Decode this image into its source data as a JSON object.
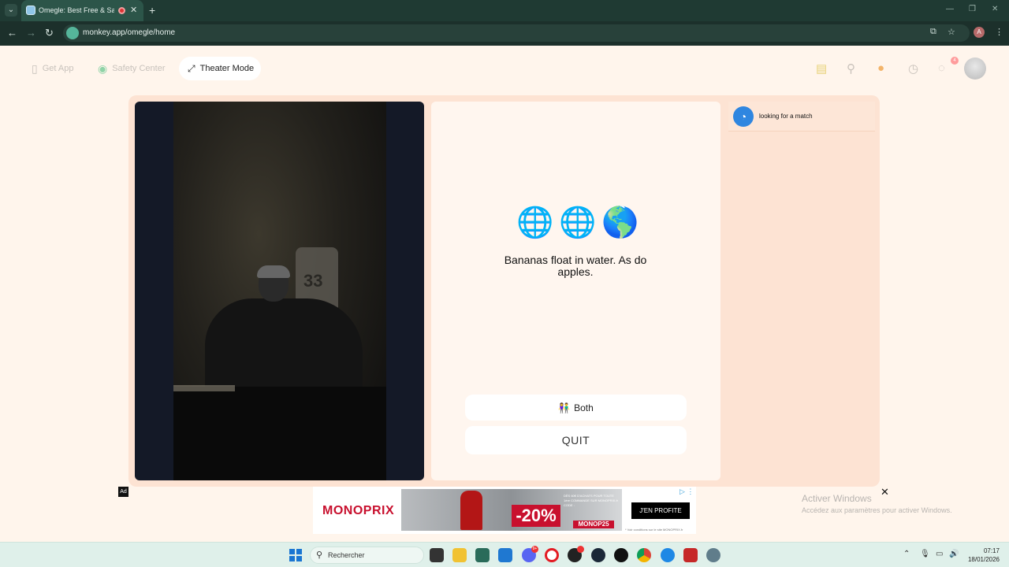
{
  "browser": {
    "tab_title": "Omegle: Best Free & Safe V",
    "tab_close": "✕",
    "new_tab": "+",
    "url": "monkey.app/omegle/home",
    "profile_initial": "A"
  },
  "header": {
    "get_app": "Get App",
    "safety_center": "Safety Center",
    "theater_mode": "Theater Mode",
    "notification_count": "4"
  },
  "video": {
    "jersey_number": "33"
  },
  "center": {
    "fact": "Bananas float in water. As do apples.",
    "gender_filter": "Both",
    "quit": "QUIT"
  },
  "side": {
    "status": "looking for a match"
  },
  "ad": {
    "tag": "Ad",
    "brand": "MONOPRIX",
    "discount": "-20%",
    "fine_print": "DÈS 60€ D'ACHATS POUR TOUTE 1ère COMMANDE SUR MONOPRIX.fr CODE :",
    "code": "MONOP25",
    "cta": "J'EN PROFITE",
    "legal": "* Voir conditions sur le site MONOPRIX.fr",
    "close": "✕"
  },
  "windows_watermark": {
    "title": "Activer Windows",
    "subtitle": "Accédez aux paramètres pour activer Windows."
  },
  "taskbar": {
    "search_placeholder": "Rechercher",
    "discord_badge": "9+",
    "time": "07:17",
    "date": "18/01/2026"
  },
  "colors": {
    "page_bg": "#fff5ec",
    "panel_bg": "#fde3d3",
    "accent_blue": "#2f86e0",
    "monoprix_red": "#c8102e"
  }
}
